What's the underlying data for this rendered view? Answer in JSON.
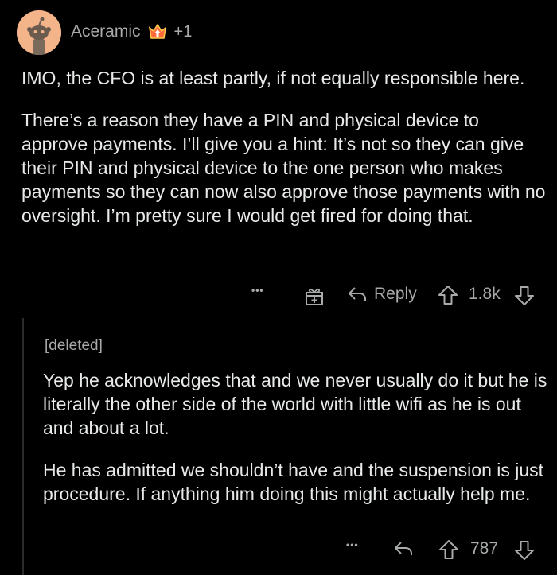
{
  "comment": {
    "author": "Aceramic",
    "award_extra": "+1",
    "paragraphs": [
      "IMO, the CFO is at least partly, if not equally responsible here.",
      "There’s a reason they have a PIN and physical device to approve payments. I’ll give you a hint:  It’s not so they can give their PIN and physical device to the one person who makes payments so they can now also approve those payments with no oversight.  I’m pretty sure I would get fired for doing that."
    ],
    "actions": {
      "more": "•••",
      "reply_label": "Reply",
      "score": "1.8k"
    }
  },
  "reply": {
    "author": "[deleted]",
    "paragraphs": [
      "Yep he acknowledges that and we never usually do it but he is literally the other side of the world with little wifi as he is out and about a lot.",
      "He has admitted we shouldn’t have and the suspension is just procedure. If anything him doing this might actually help me."
    ],
    "actions": {
      "more": "•••",
      "score": "787"
    }
  },
  "icons": [
    "snoo-avatar-icon",
    "award-icon",
    "gift-award-icon",
    "reply-arrow-icon",
    "upvote-icon",
    "downvote-icon"
  ]
}
